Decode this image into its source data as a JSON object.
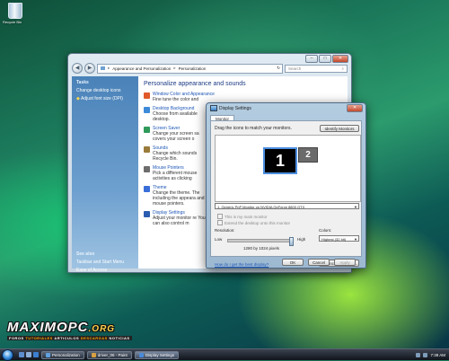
{
  "desktop": {
    "recycle_bin_label": "Recycle Bin"
  },
  "control_panel": {
    "breadcrumb": [
      "Appearance and Personalization",
      "Personalization"
    ],
    "search_placeholder": "Search",
    "sidebar": {
      "tasks_header": "Tasks",
      "tasks": [
        "Change desktop icons",
        "Adjust font size (DPI)"
      ],
      "see_also_header": "See also",
      "see_also": [
        "Taskbar and Start Menu",
        "Ease of Access"
      ]
    },
    "title": "Personalize appearance and sounds",
    "categories": [
      {
        "title": "Window Color and Appearance",
        "desc": "Fine tune the color and",
        "color": "#e05a2a"
      },
      {
        "title": "Desktop Background",
        "desc": "Choose from available desktop.",
        "color": "#3c8ad8"
      },
      {
        "title": "Screen Saver",
        "desc": "Change your screen sa covers your screen o",
        "color": "#2f9a5a"
      },
      {
        "title": "Sounds",
        "desc": "Change which sounds Recycle Bin.",
        "color": "#9a7b3c"
      },
      {
        "title": "Mouse Pointers",
        "desc": "Pick a different mouse activities as clicking",
        "color": "#6d6d6d"
      },
      {
        "title": "Theme",
        "desc": "Change the theme. The including the appeara and mouse pointers.",
        "color": "#3a6ed8"
      },
      {
        "title": "Display Settings",
        "desc": "Adjust your monitor re You can also control m",
        "color": "#2a5cb0"
      }
    ]
  },
  "display_settings": {
    "title": "Display Settings",
    "tab": "Monitor",
    "instruction": "Drag the icons to match your monitors.",
    "identify_button": "Identify Monitors",
    "monitor1": "1",
    "monitor2": "2",
    "monitor_select": "1. Generic PnP Monitor on NVIDIA GeForce 8800 GTX",
    "checkbox_main": "This is my main monitor",
    "checkbox_extend": "Extend the desktop onto this monitor",
    "resolution_label": "Resolution:",
    "low_label": "Low",
    "high_label": "High",
    "resolution_value": "1280 by 1024 pixels",
    "resolution_level": 0.97,
    "colors_label": "Colors:",
    "colors_value": "Highest (32 bit)",
    "help_link": "How do I get the best display?",
    "advanced_button": "Advanced Settings...",
    "ok": "OK",
    "cancel": "Cancel",
    "apply": "Apply"
  },
  "watermark": {
    "logo_maximo": "MAXIMO",
    "logo_pc": "PC",
    "logo_org": ".ORG",
    "tagline_a": "FOROS",
    "tagline_b": "TUTORIALES",
    "tagline_c": "ARTICULOS",
    "tagline_d": "DESCARGAS",
    "tagline_e": "NOTICIAS"
  },
  "taskbar": {
    "buttons": [
      {
        "label": "Personalization",
        "color": "#5fa0e0"
      },
      {
        "label": "driver_06 - Paint",
        "color": "#d8a040"
      },
      {
        "label": "Display Settings",
        "color": "#4a8ad8"
      }
    ],
    "clock": "7:38 AM"
  }
}
